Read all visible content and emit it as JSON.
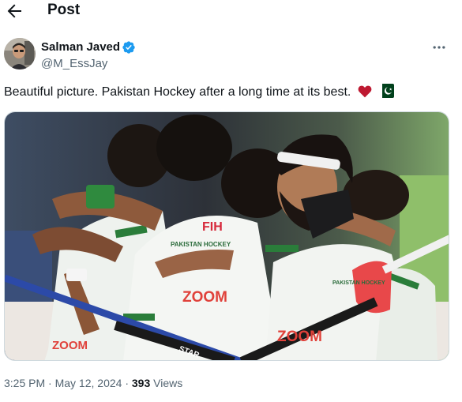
{
  "header": {
    "title": "Post",
    "back_icon": "arrow-left-icon"
  },
  "author": {
    "display_name": "Salman Javed",
    "handle": "@M_EssJay",
    "verified_color": "#1d9bf0",
    "verified_icon": "verified-badge-icon"
  },
  "tweet": {
    "text": "Beautiful picture. Pakistan Hockey after a long time at its best.",
    "emojis": [
      "heart-emoji",
      "pakistan-flag-emoji"
    ]
  },
  "media": {
    "jersey_texts": [
      "FIH",
      "PAKISTAN HOCKEY",
      "ZOOM",
      "ZOOM",
      "PAKISTAN HOCKEY",
      "ZOOM",
      "STAR"
    ]
  },
  "meta": {
    "time": "3:25 PM",
    "separator": "·",
    "date": "May 12, 2024",
    "views_count": "393",
    "views_label": "Views"
  },
  "colors": {
    "text": "#0f1419",
    "secondary": "#536471",
    "accent": "#1d9bf0",
    "pak_green": "#01411c"
  }
}
